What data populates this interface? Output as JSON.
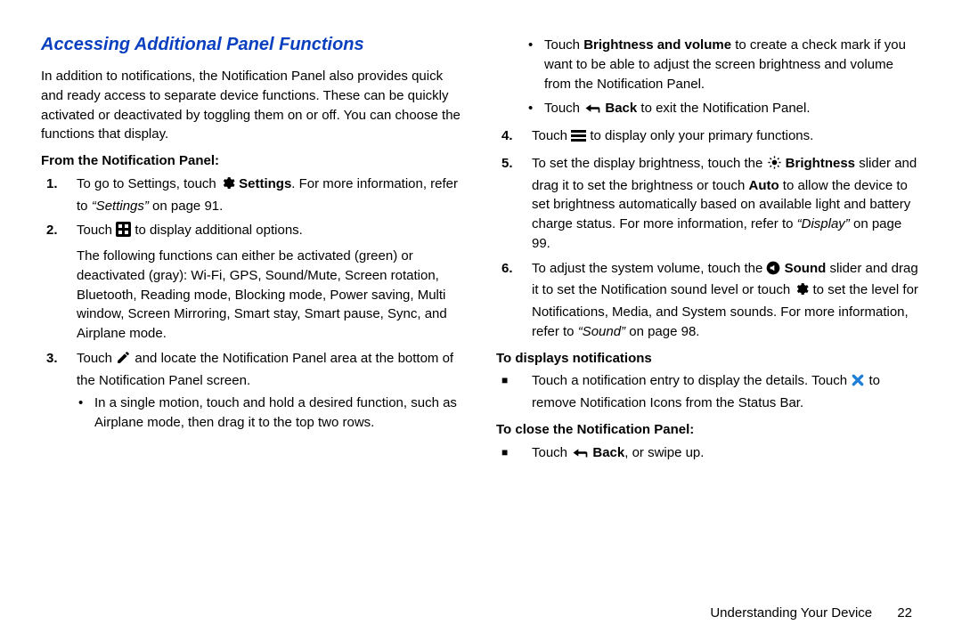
{
  "title": "Accessing Additional Panel Functions",
  "intro": "In addition to notifications, the Notification Panel also provides quick and ready access to separate device functions. These can be quickly activated or deactivated by toggling them on or off. You can choose the functions that display.",
  "subhead1": "From the Notification Panel:",
  "li1a": "To go to Settings, touch ",
  "li1_settings": "Settings",
  "li1b": ". For more information, refer to ",
  "li1_ref": "“Settings”",
  "li1c": " on page 91.",
  "li2a": "Touch ",
  "li2b": " to display additional options.",
  "li2c": "The following functions can either be activated (green) or deactivated (gray): Wi-Fi, GPS, Sound/Mute, Screen rotation, Bluetooth, Reading mode, Blocking mode, Power saving, Multi window, Screen Mirroring, Smart stay, Smart pause, Sync, and Airplane mode.",
  "li3a": "Touch ",
  "li3b": " and locate the Notification Panel area at the bottom of the Notification Panel screen.",
  "li3_bul1": "In a single motion, touch and hold a desired function, such as Airplane mode, then drag it to the top two rows.",
  "li3_bul2a": "Touch ",
  "li3_bul2_bold": "Brightness and volume",
  "li3_bul2b": " to create a check mark if you want to be able to adjust the screen brightness and volume from the Notification Panel.",
  "li3_bul3a": "Touch ",
  "li3_bul3_bold": "Back",
  "li3_bul3b": " to exit the Notification Panel.",
  "li4a": "Touch ",
  "li4b": " to display only your primary functions.",
  "li5a": "To set the display brightness, touch the ",
  "li5_bold1": "Brightness",
  "li5b": " slider and drag it to set the brightness or touch ",
  "li5_bold2": "Auto",
  "li5c": " to allow the device to set brightness automatically based on available light and battery charge status. For more information, refer to ",
  "li5_ref": "“Display”",
  "li5d": " on page 99.",
  "li6a": "To adjust the system volume, touch the ",
  "li6_bold1": "Sound",
  "li6b": " slider and drag it to set the Notification sound level or touch ",
  "li6c": " to set the level for Notifications, Media, and System sounds. For more information, refer to ",
  "li6_ref": "“Sound”",
  "li6d": " on page 98.",
  "subhead2": "To displays notifications",
  "sq1a": "Touch a notification entry to display the details. Touch ",
  "sq1b": " to remove Notification Icons from the Status Bar.",
  "subhead3": "To close the Notification Panel:",
  "sq2a": "Touch ",
  "sq2_bold": "Back",
  "sq2b": ", or swipe up.",
  "footer_text": "Understanding Your Device",
  "footer_page": "22"
}
